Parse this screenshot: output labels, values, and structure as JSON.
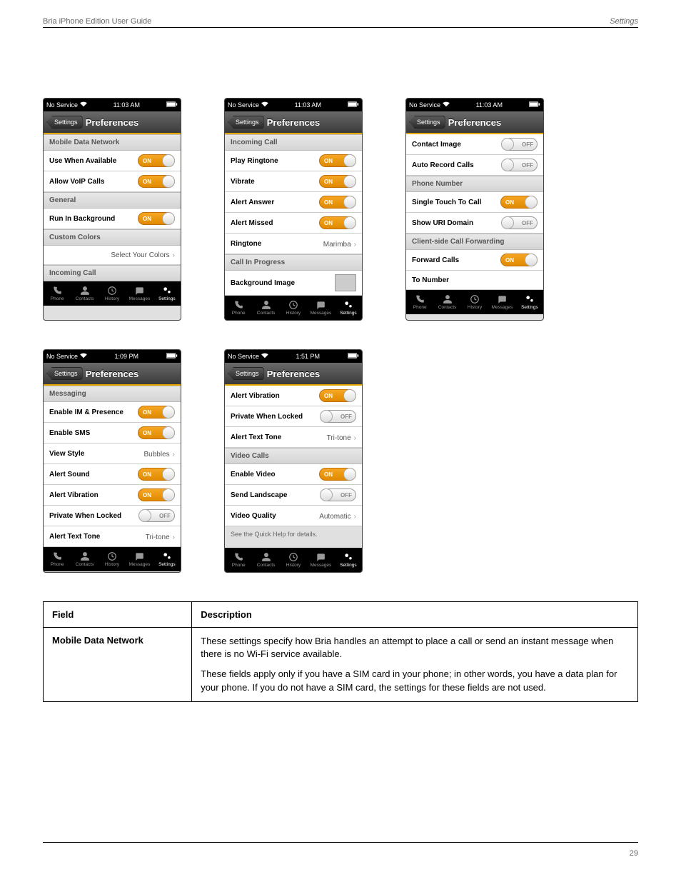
{
  "header": {
    "left": "Bria iPhone Edition User Guide",
    "right": "Settings"
  },
  "footer": {
    "page": "29"
  },
  "common": {
    "status": {
      "carrier": "No Service",
      "wifi": true,
      "batteryIcon": true
    },
    "nav": {
      "back": "Settings",
      "title": "Preferences"
    },
    "tabs": [
      {
        "label": "Phone",
        "icon": "phone-icon"
      },
      {
        "label": "Contacts",
        "icon": "contacts-icon"
      },
      {
        "label": "History",
        "icon": "history-icon"
      },
      {
        "label": "Messages",
        "icon": "messages-icon"
      },
      {
        "label": "Settings",
        "icon": "settings-icon",
        "active": true
      }
    ],
    "toggle": {
      "on": "ON",
      "off": "OFF"
    }
  },
  "screens": [
    {
      "time": "11:03 AM",
      "groups": [
        {
          "header": "Mobile Data Network",
          "rows": [
            {
              "type": "toggle",
              "label": "Use When Available",
              "state": "on"
            },
            {
              "type": "toggle",
              "label": "Allow VoIP Calls",
              "state": "on"
            }
          ]
        },
        {
          "header": "General",
          "rows": [
            {
              "type": "toggle",
              "label": "Run In Background",
              "state": "on"
            }
          ]
        },
        {
          "header": "Custom Colors",
          "rows": [
            {
              "type": "disclosure",
              "value": "Select Your Colors"
            }
          ]
        },
        {
          "header": "Incoming Call",
          "rows": []
        }
      ]
    },
    {
      "time": "11:03 AM",
      "groups": [
        {
          "header": "Incoming Call",
          "rows": [
            {
              "type": "toggle",
              "label": "Play Ringtone",
              "state": "on"
            },
            {
              "type": "toggle",
              "label": "Vibrate",
              "state": "on"
            },
            {
              "type": "toggle",
              "label": "Alert Answer",
              "state": "on"
            },
            {
              "type": "toggle",
              "label": "Alert Missed",
              "state": "on"
            },
            {
              "type": "detail",
              "label": "Ringtone",
              "value": "Marimba"
            }
          ]
        },
        {
          "header": "Call In Progress",
          "rows": [
            {
              "type": "thumb",
              "label": "Background Image"
            }
          ]
        }
      ]
    },
    {
      "time": "11:03 AM",
      "groups": [
        {
          "rows": [
            {
              "type": "toggle",
              "label": "Contact Image",
              "state": "off"
            },
            {
              "type": "toggle",
              "label": "Auto Record Calls",
              "state": "off"
            }
          ]
        },
        {
          "header": "Phone Number",
          "rows": [
            {
              "type": "toggle",
              "label": "Single Touch To Call",
              "state": "on"
            },
            {
              "type": "toggle",
              "label": "Show URI Domain",
              "state": "off"
            }
          ]
        },
        {
          "header": "Client-side Call Forwarding",
          "rows": [
            {
              "type": "toggle",
              "label": "Forward Calls",
              "state": "on"
            },
            {
              "type": "plain",
              "label": "To Number"
            }
          ]
        }
      ]
    },
    {
      "time": "1:09 PM",
      "groups": [
        {
          "header": "Messaging",
          "rows": [
            {
              "type": "toggle",
              "label": "Enable IM & Presence",
              "state": "on"
            },
            {
              "type": "toggle",
              "label": "Enable SMS",
              "state": "on"
            },
            {
              "type": "detail",
              "label": "View Style",
              "value": "Bubbles"
            },
            {
              "type": "toggle",
              "label": "Alert Sound",
              "state": "on"
            },
            {
              "type": "toggle",
              "label": "Alert Vibration",
              "state": "on"
            },
            {
              "type": "toggle",
              "label": "Private When Locked",
              "state": "off"
            },
            {
              "type": "detail",
              "label": "Alert Text Tone",
              "value": "Tri-tone"
            }
          ]
        }
      ]
    },
    {
      "time": "1:51 PM",
      "groups": [
        {
          "rows": [
            {
              "type": "toggle",
              "label": "Alert Vibration",
              "state": "on"
            },
            {
              "type": "toggle",
              "label": "Private When Locked",
              "state": "off"
            },
            {
              "type": "detail",
              "label": "Alert Text Tone",
              "value": "Tri-tone"
            }
          ]
        },
        {
          "header": "Video Calls",
          "rows": [
            {
              "type": "toggle",
              "label": "Enable Video",
              "state": "on"
            },
            {
              "type": "toggle",
              "label": "Send Landscape",
              "state": "off"
            },
            {
              "type": "detail",
              "label": "Video Quality",
              "value": "Automatic"
            }
          ]
        },
        {
          "info": "See the Quick Help for details."
        }
      ]
    }
  ],
  "table": {
    "head": [
      "Field",
      "Description"
    ],
    "rows": [
      {
        "field": "Mobile Data Network",
        "desc": [
          "These settings specify how Bria handles an attempt to place a call or send an instant message when there is no Wi-Fi service available.",
          "These fields apply only if you have a SIM card in your phone; in other words, you have a data plan for your phone. If you do not have a SIM card, the settings for these fields are not used."
        ]
      }
    ]
  }
}
